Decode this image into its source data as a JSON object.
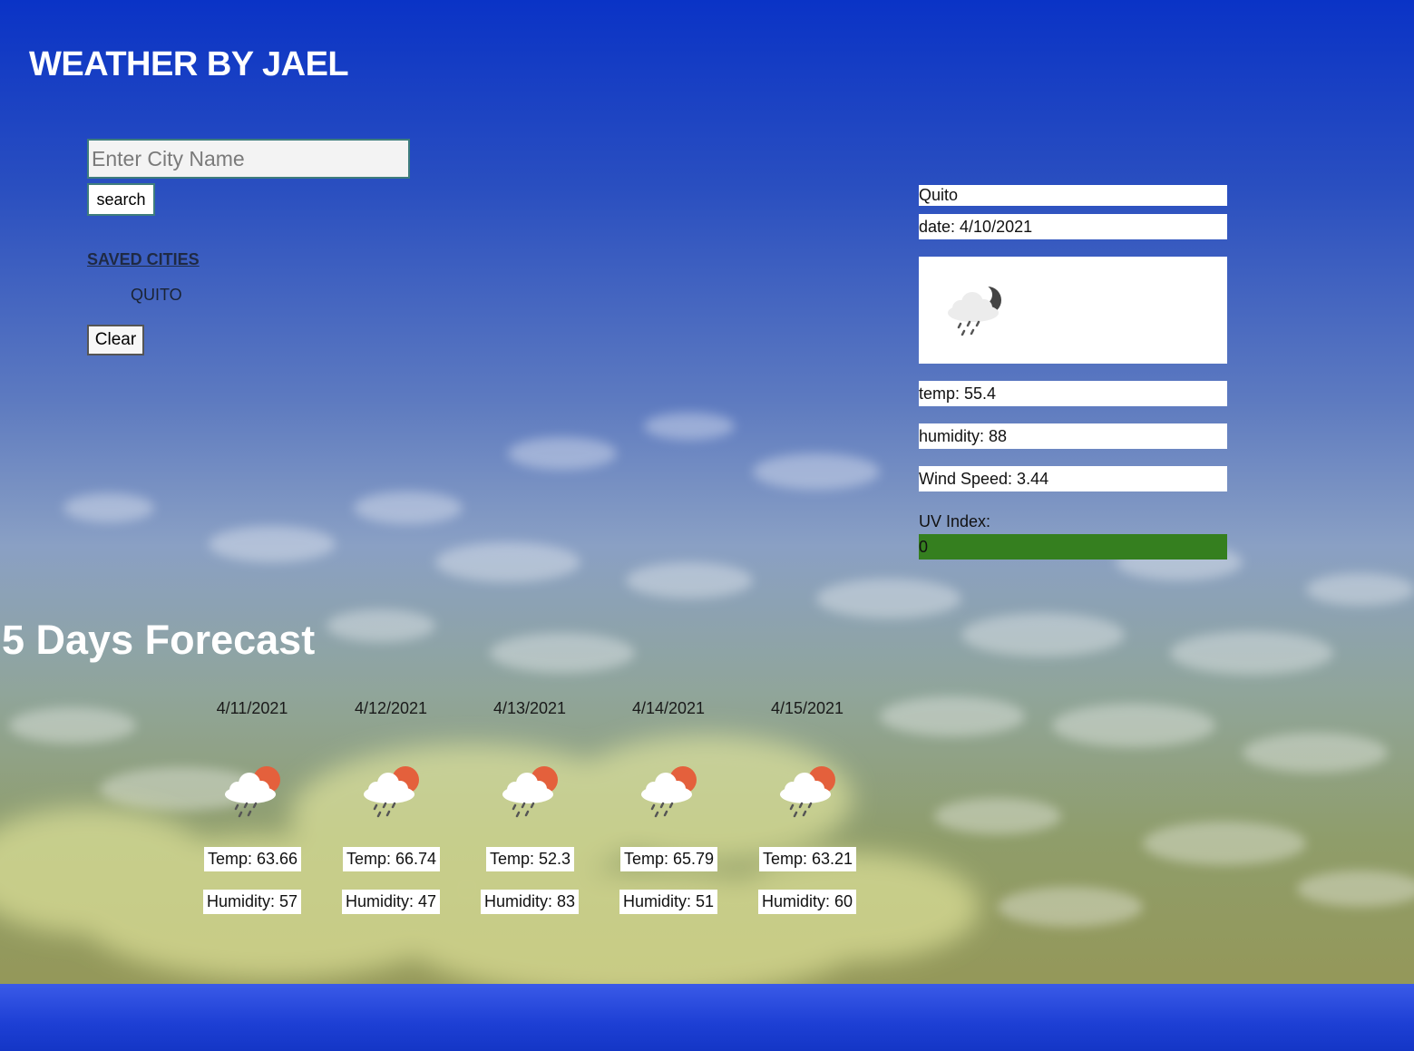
{
  "app": {
    "title": "WEATHER BY JAEL"
  },
  "search": {
    "placeholder": "Enter City Name",
    "value": "",
    "button_label": "search"
  },
  "saved": {
    "heading": "SAVED CITIES",
    "cities": [
      "QUITO"
    ],
    "clear_label": "Clear"
  },
  "current": {
    "city": "Quito",
    "date": "date: 4/10/2021",
    "icon": "rain-cloud-night-icon",
    "temp": "temp: 55.4",
    "humidity": "humidity: 88",
    "wind": "Wind Speed: 3.44",
    "uv_label": "UV Index:",
    "uv_value": "0",
    "uv_color": "#357f1f"
  },
  "forecast": {
    "heading": "5 Days Forecast",
    "days": [
      {
        "date": "4/11/2021",
        "icon": "rain-cloud-sun-icon",
        "temp": "Temp: 63.66",
        "humidity": "Humidity: 57"
      },
      {
        "date": "4/12/2021",
        "icon": "rain-cloud-sun-icon",
        "temp": "Temp: 66.74",
        "humidity": "Humidity: 47"
      },
      {
        "date": "4/13/2021",
        "icon": "rain-cloud-sun-icon",
        "temp": "Temp: 52.3",
        "humidity": "Humidity: 83"
      },
      {
        "date": "4/14/2021",
        "icon": "rain-cloud-sun-icon",
        "temp": "Temp: 65.79",
        "humidity": "Humidity: 51"
      },
      {
        "date": "4/15/2021",
        "icon": "rain-cloud-sun-icon",
        "temp": "Temp: 63.21",
        "humidity": "Humidity: 60"
      }
    ]
  },
  "colors": {
    "sun": "#e4603c",
    "moon": "#444444",
    "cloud": "#ffffff",
    "rain": "#555555"
  }
}
